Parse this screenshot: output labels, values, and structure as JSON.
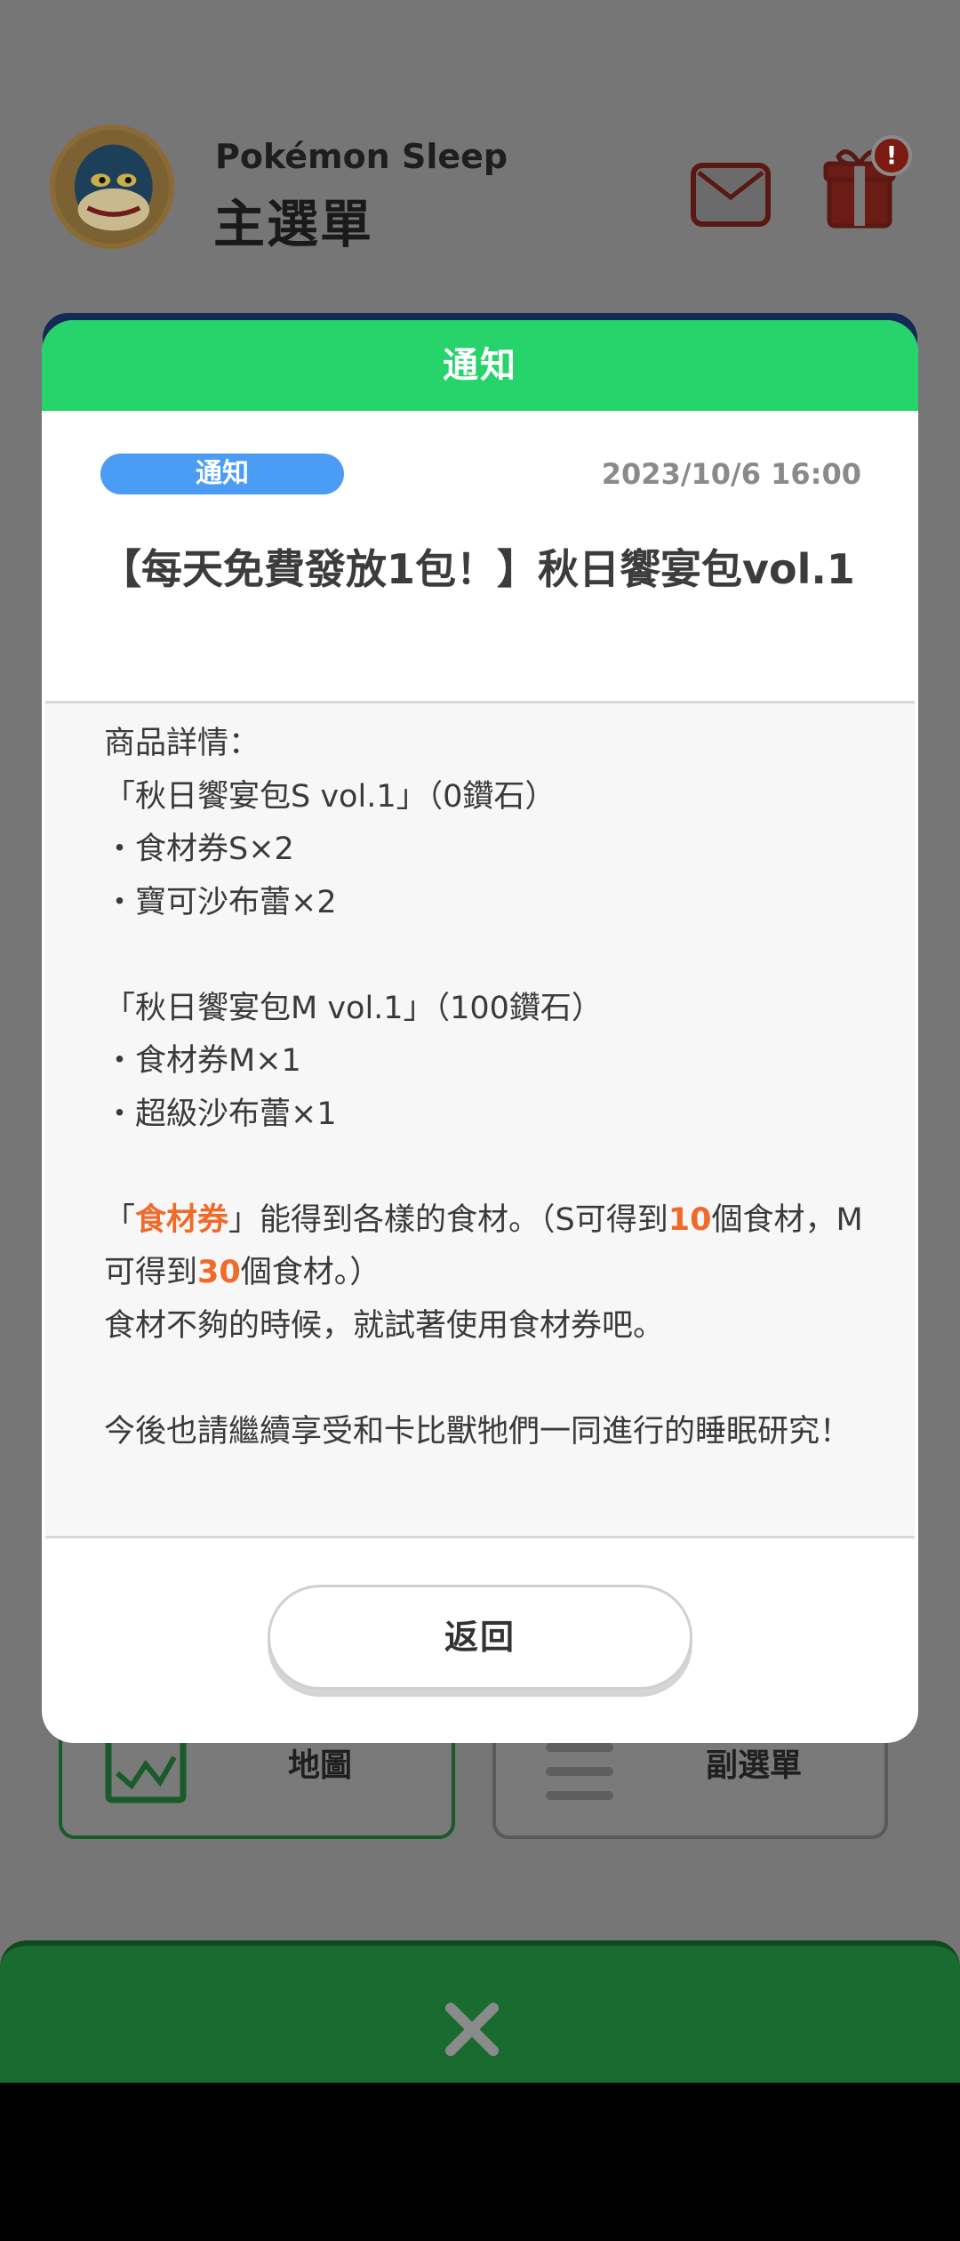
{
  "header": {
    "game_title": "Pokémon Sleep",
    "menu_title": "主選單",
    "gift_badge": "!"
  },
  "background_buttons": {
    "map_label": "地圖",
    "submenu_label": "副選單"
  },
  "dialog": {
    "header": "通知",
    "tag": "通知",
    "date": "2023/10/6 16:00",
    "title": "【每天免費發放1包！】秋日饗宴包vol.1",
    "body": {
      "l1": "商品詳情：",
      "l2": "「秋日饗宴包S vol.1」（0鑽石）",
      "l3": "・食材券S×2",
      "l4": "・寶可沙布蕾×2",
      "l5": "「秋日饗宴包M vol.1」（100鑽石）",
      "l6": "・食材券M×1",
      "l7": "・超級沙布蕾×1",
      "p_a": "「",
      "p_hl1": "食材券",
      "p_b": "」能得到各樣的食材。（S可得到",
      "p_hl2": "10",
      "p_c": "個食材，M可得到",
      "p_hl3": "30",
      "p_d": "個食材。）",
      "l9": "食材不夠的時候，就試著使用食材券吧。",
      "l10": "今後也請繼續享受和卡比獸牠們一同進行的睡眠研究！"
    },
    "back_label": "返回"
  },
  "colors": {
    "header_green": "#27d36b",
    "tag_blue": "#4a9cf4",
    "highlight_orange": "#f06a2a"
  }
}
